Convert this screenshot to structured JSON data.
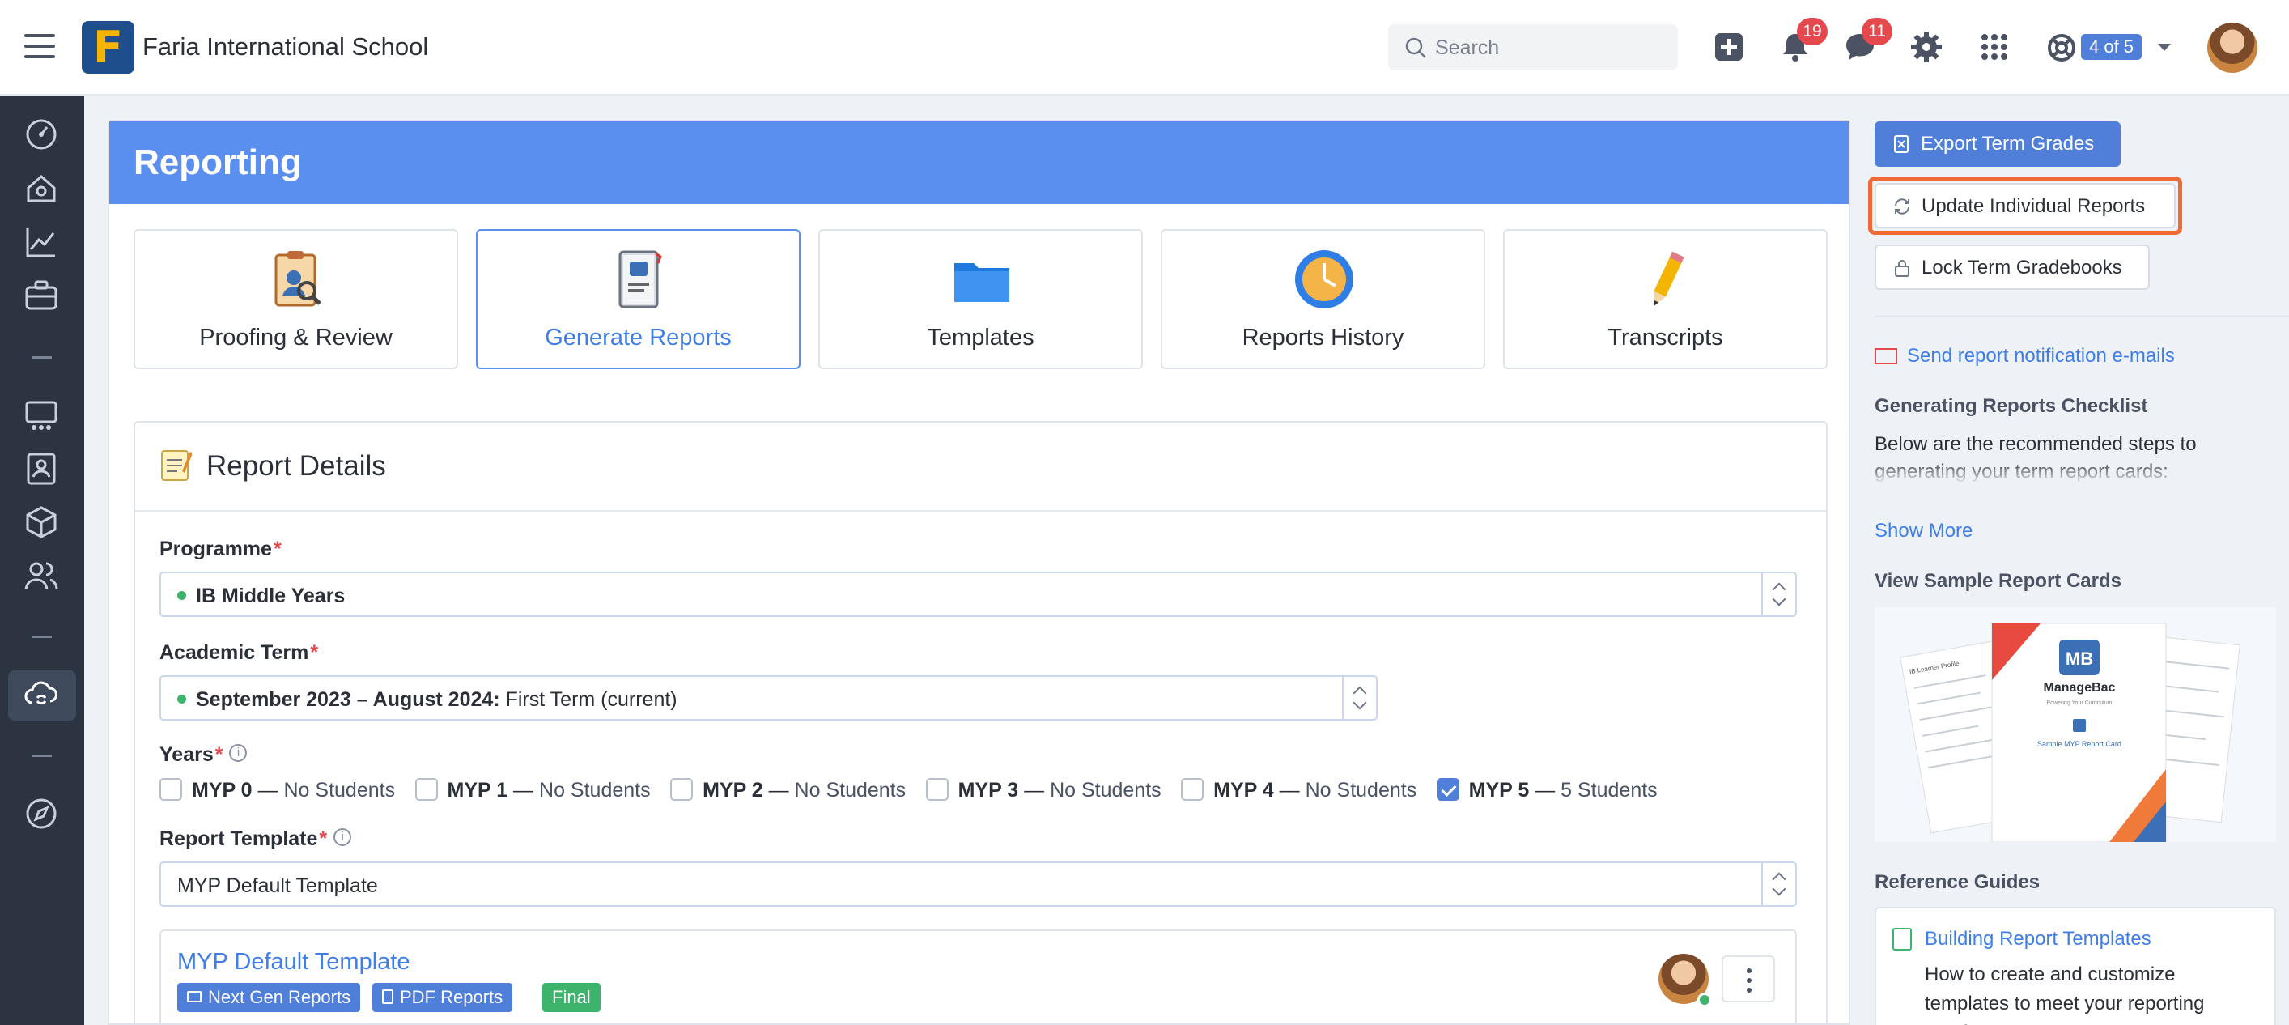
{
  "topbar": {
    "school_name": "Faria International School",
    "logo_letter": "F",
    "search_placeholder": "Search",
    "notifications_count": "19",
    "messages_count": "11",
    "user_switch_label": "4 of 5"
  },
  "sidebar": {
    "items": [
      "dashboard-icon",
      "home-icon",
      "analytics-icon",
      "briefcase-icon",
      "classroom-icon",
      "teacher-icon",
      "cube-icon",
      "people-icon",
      "cloud-sync-icon",
      "compass-icon"
    ]
  },
  "page": {
    "title": "Reporting"
  },
  "tiles": [
    {
      "label": "Proofing & Review"
    },
    {
      "label": "Generate Reports"
    },
    {
      "label": "Templates"
    },
    {
      "label": "Reports History"
    },
    {
      "label": "Transcripts"
    }
  ],
  "details": {
    "title": "Report Details",
    "programme_label": "Programme",
    "programme_value": "IB Middle Years",
    "term_label": "Academic Term",
    "term_value_bold": "September 2023 – August 2024:",
    "term_value_rest": " First Term (current)",
    "years_label": "Years",
    "years": [
      {
        "name": "MYP 0",
        "count": "No Students",
        "checked": false
      },
      {
        "name": "MYP 1",
        "count": "No Students",
        "checked": false
      },
      {
        "name": "MYP 2",
        "count": "No Students",
        "checked": false
      },
      {
        "name": "MYP 3",
        "count": "No Students",
        "checked": false
      },
      {
        "name": "MYP 4",
        "count": "No Students",
        "checked": false
      },
      {
        "name": "MYP 5",
        "count": "5 Students",
        "checked": true
      }
    ],
    "year_sep": " — ",
    "template_label": "Report Template",
    "template_value": "MYP Default Template",
    "required_mark": "*",
    "info_mark": "i"
  },
  "template_card": {
    "title": "MYP Default Template",
    "tags": [
      "Next Gen Reports",
      "PDF Reports",
      "Final"
    ]
  },
  "right": {
    "export_label": "Export Term Grades",
    "update_label": "Update Individual Reports",
    "lock_label": "Lock Term Gradebooks",
    "notify_link": "Send report notification e-mails",
    "checklist_heading": "Generating Reports Checklist",
    "checklist_body": "Below are the recommended steps to generating your term report cards:",
    "show_more": "Show More",
    "sample_heading": "View Sample Report Cards",
    "sample": {
      "brand": "ManageBac",
      "tagline": "Powering Your Curriculum",
      "card_title": "Sample MYP Report Card",
      "back_page_title": "IB Learner Profile"
    },
    "guides_heading": "Reference Guides",
    "guide_title": "Building Report Templates",
    "guide_desc": "How to create and customize templates to meet your reporting needs."
  },
  "colors": {
    "accent": "#5a8ff0",
    "sidebar": "#2c3441",
    "badge": "#e5484d",
    "highlight": "#ee6a36",
    "success": "#3db36b"
  }
}
